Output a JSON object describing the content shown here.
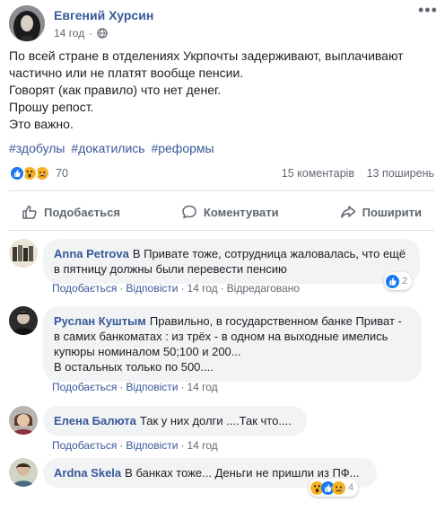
{
  "post": {
    "author": "Евгений Хурсин",
    "time": "14 год",
    "privacy_icon": "globe-icon",
    "more_icon": "ellipsis-icon",
    "text_lines": [
      "По всей стране в отделениях Укрпочты задерживают, выплачивают",
      "частично или не платят вообще пенсии.",
      "Говорят (как правило) что нет денег.",
      "Прошу репост.",
      "Это важно."
    ],
    "hashtags": [
      "#здобулы",
      "#докатились",
      "#реформы"
    ],
    "reactions": {
      "icons": [
        "like-icon",
        "wow-icon",
        "sad-icon"
      ],
      "count": "70"
    },
    "comments_count": "15 коментарів",
    "shares_count": "13 поширень",
    "actions": {
      "like": "Подобається",
      "comment": "Коментувати",
      "share": "Поширити"
    }
  },
  "comments": [
    {
      "name": "Anna Petrova",
      "lines": [
        "В Привате тоже, сотрудница жаловалась, что ещё",
        "в пятницу должны были перевести пенсию"
      ],
      "like": "Подобається",
      "reply": "Відповісти",
      "time": "14 год",
      "edited": "Відредаговано",
      "reaction_count": "2"
    },
    {
      "name": "Руслан Куштым",
      "lines": [
        "Правильно, в государственном банке Приват -",
        "в самих банкоматах : из трёх - в одном на выходные имелись",
        "купюры номиналом 50;100 и 200...",
        "В остальных только по 500...."
      ],
      "like": "Подобається",
      "reply": "Відповісти",
      "time": "14 год"
    },
    {
      "name": "Елена Балюта",
      "lines": [
        "Так у них долги ....Так что...."
      ],
      "like": "Подобається",
      "reply": "Відповісти",
      "time": "14 год"
    },
    {
      "name": "Ardna Skela",
      "lines": [
        "В банках тоже... Деньги не пришли из ПФ..."
      ],
      "reaction_count": "4"
    }
  ],
  "colors": {
    "link": "#385898",
    "muted": "#606770",
    "bubble": "#f2f3f5",
    "like_blue": "#1877f2",
    "emoji_yellow": "#f7b125"
  }
}
